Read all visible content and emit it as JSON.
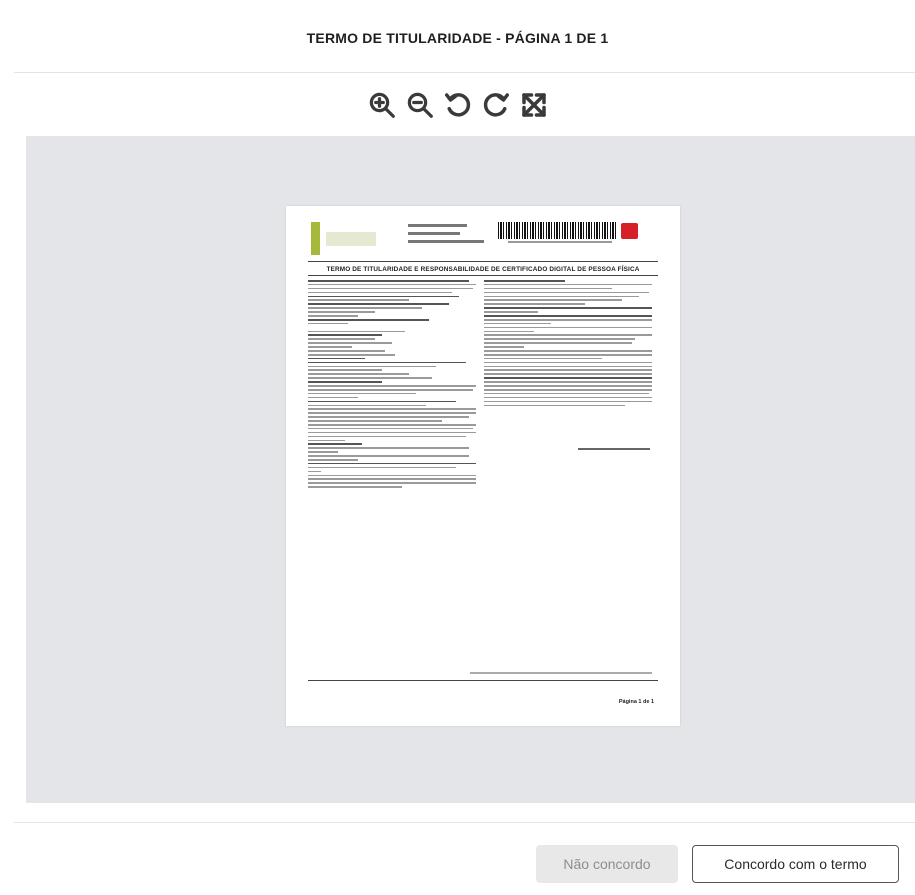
{
  "header": {
    "title": "TERMO DE TITULARIDADE - PÁGINA 1 DE 1"
  },
  "toolbar": {
    "tools": [
      {
        "name": "zoom-in-icon"
      },
      {
        "name": "zoom-out-icon"
      },
      {
        "name": "rotate-left-icon"
      },
      {
        "name": "rotate-right-icon"
      },
      {
        "name": "fit-screen-icon"
      }
    ],
    "icon_color": "#3a3a3a"
  },
  "viewer": {
    "background": "#e3e5e8",
    "document": {
      "title": "TERMO DE TITULARIDADE E RESPONSABILIDADE DE CERTIFICADO DIGITAL DE PESSOA FÍSICA",
      "page_label": "Página 1 de 1"
    }
  },
  "actions": {
    "disagree_label": "Não concordo",
    "agree_label": "Concordo com o termo"
  }
}
